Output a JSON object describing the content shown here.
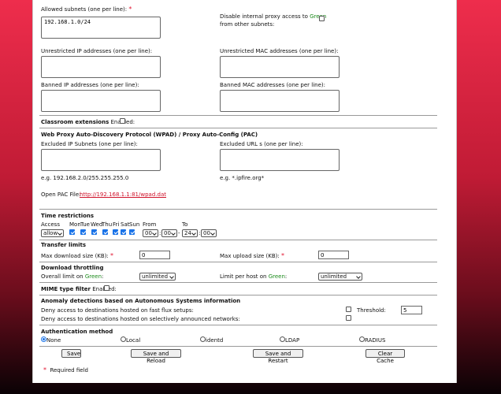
{
  "form": {
    "allowed_subnets": {
      "label": "Allowed subnets (one per line):",
      "value": "192.168.1.0/24"
    },
    "disable_internal_proxy": {
      "label_pre": "Disable internal proxy access to ",
      "label_color": "Green",
      "label_post": "from other subnets:"
    },
    "unrestricted_ip": {
      "label": "Unrestricted IP addresses (one per line):"
    },
    "unrestricted_mac": {
      "label": "Unrestricted MAC addresses (one per line):"
    },
    "banned_ip": {
      "label": "Banned IP addresses (one per line):"
    },
    "banned_mac": {
      "label": "Banned MAC addresses (one per line):"
    }
  },
  "classroom": {
    "title": "Classroom extensions",
    "enabled_label": "Enabled:"
  },
  "wpad": {
    "title": "Web Proxy Auto-Discovery Protocol (WPAD) / Proxy Auto-Config (PAC)",
    "excluded_subnets_label": "Excluded IP Subnets (one per line):",
    "excluded_urls_label": "Excluded URL s (one per line):",
    "subnet_example": "e.g. 192.168.2.0/255.255.255.0",
    "url_example": "e.g. *.ipfire.org*",
    "pac_label": "Open PAC File:",
    "pac_link": "http://192.168.1.1:81/wpad.dat"
  },
  "time": {
    "title": "Time restrictions",
    "access_label": "Access",
    "access_value": "allow",
    "days": [
      {
        "label": "Mon",
        "checked": true
      },
      {
        "label": "Tue",
        "checked": true
      },
      {
        "label": "Wed",
        "checked": true
      },
      {
        "label": "Thu",
        "checked": true
      },
      {
        "label": "Fri",
        "checked": true
      },
      {
        "label": "Sat",
        "checked": true
      },
      {
        "label": "Sun",
        "checked": true
      }
    ],
    "from_label": "From",
    "to_label": "To",
    "from_hour": "00",
    "from_min": "00",
    "to_hour": "24",
    "to_min": "00",
    "dash": "-"
  },
  "transfer": {
    "title": "Transfer limits",
    "max_download_label": "Max download size (KB):",
    "max_download_value": "0",
    "max_upload_label": "Max upload size (KB):",
    "max_upload_value": "0"
  },
  "throttle": {
    "title": "Download throttling",
    "overall_pre": "Overall limit on ",
    "overall_color": "Green",
    "overall_post": ":",
    "overall_value": "unlimited",
    "perhost_pre": "Limit per host on ",
    "perhost_color": "Green",
    "perhost_post": ":",
    "perhost_value": "unlimited"
  },
  "mime": {
    "title": "MIME type filter",
    "enabled_label": "Enabled:"
  },
  "anomaly": {
    "title": "Anomaly detections based on Autonomous Systems information",
    "fast_flux_label": "Deny access to destinations hosted on fast flux setups:",
    "threshold_label": "Threshold:",
    "threshold_value": "5",
    "selective_label": "Deny access to destinations hosted on selectively announced networks:"
  },
  "auth": {
    "title": "Authentication method",
    "options": [
      {
        "label": "None",
        "selected": true
      },
      {
        "label": "Local",
        "selected": false
      },
      {
        "label": "identd",
        "selected": false
      },
      {
        "label": "LDAP",
        "selected": false
      },
      {
        "label": "RADIUS",
        "selected": false
      }
    ]
  },
  "buttons": {
    "save": "Save",
    "save_reload": "Save and Reload",
    "save_restart": "Save and Restart",
    "clear_cache": "Clear Cache"
  },
  "required": {
    "star": "*",
    "text": "Required field"
  },
  "colors": {
    "accent_green": "#1b8a1b",
    "required_red": "#e2132f",
    "checkbox_blue": "#1a73e8",
    "page_gradient_top": "#ee2d4c"
  }
}
